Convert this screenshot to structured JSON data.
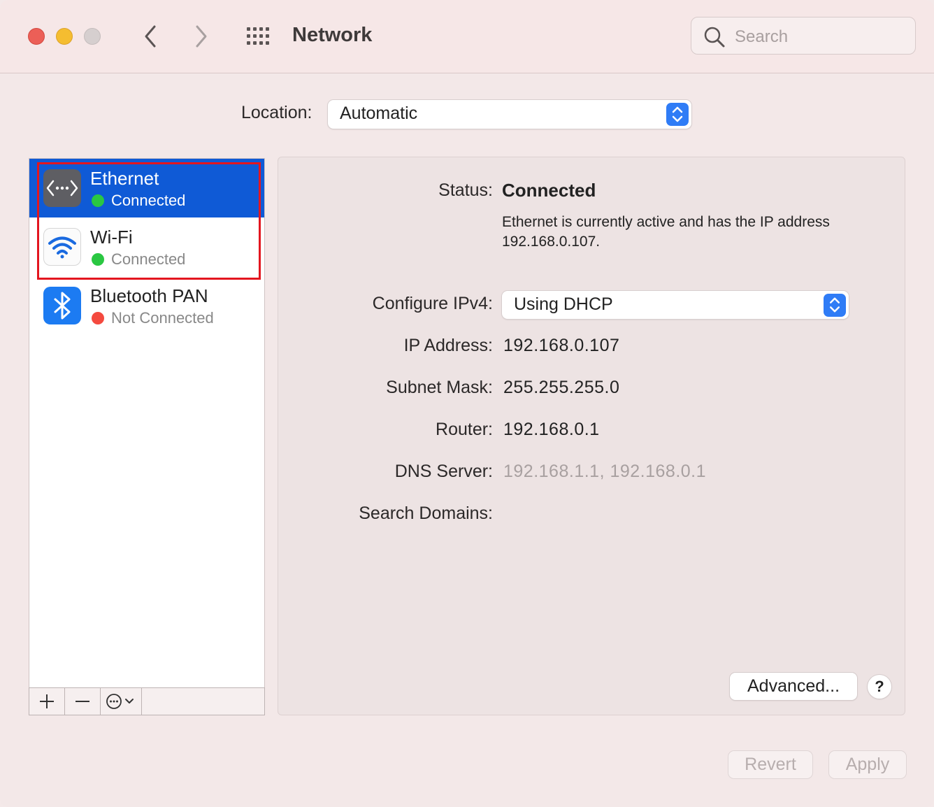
{
  "window": {
    "title": "Network",
    "search_placeholder": "Search"
  },
  "location": {
    "label": "Location:",
    "value": "Automatic"
  },
  "services": [
    {
      "name": "Ethernet",
      "status": "Connected",
      "status_color": "#2ac742",
      "icon": "ethernet-icon",
      "selected": true
    },
    {
      "name": "Wi-Fi",
      "status": "Connected",
      "status_color": "#2ac742",
      "icon": "wifi-icon",
      "selected": false
    },
    {
      "name": "Bluetooth PAN",
      "status": "Not Connected",
      "status_color": "#f44a3f",
      "icon": "bluetooth-icon",
      "selected": false
    }
  ],
  "toolbar": {
    "add": "+",
    "remove": "—"
  },
  "details": {
    "status_label": "Status:",
    "status_value": "Connected",
    "status_description": "Ethernet is currently active and has the IP address 192.168.0.107.",
    "configure_label": "Configure IPv4:",
    "configure_value": "Using DHCP",
    "ip_label": "IP Address:",
    "ip_value": "192.168.0.107",
    "subnet_label": "Subnet Mask:",
    "subnet_value": "255.255.255.0",
    "router_label": "Router:",
    "router_value": "192.168.0.1",
    "dns_label": "DNS Server:",
    "dns_value": "192.168.1.1, 192.168.0.1",
    "search_domains_label": "Search Domains:",
    "search_domains_value": ""
  },
  "buttons": {
    "advanced": "Advanced...",
    "help": "?",
    "revert": "Revert",
    "apply": "Apply"
  },
  "colors": {
    "selection": "#0f5ad6",
    "accent": "#2f7cf6",
    "highlight_box": "#e3161f"
  }
}
